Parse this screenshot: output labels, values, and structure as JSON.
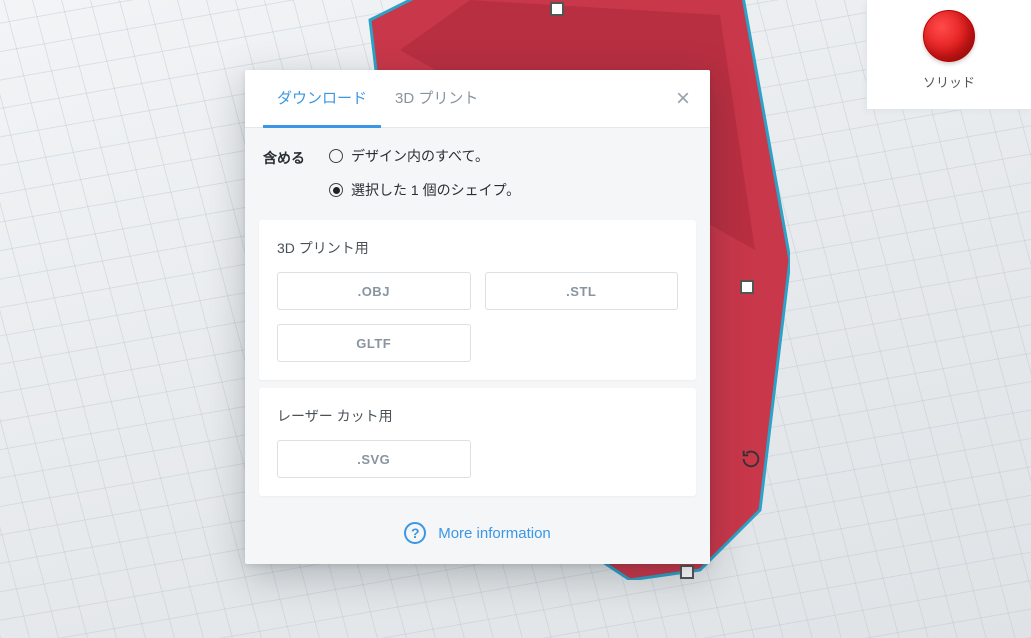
{
  "palette": {
    "label": "ソリッド",
    "swatch_color": "#e01919"
  },
  "dialog": {
    "tabs": {
      "download": "ダウンロード",
      "print3d": "3D プリント"
    },
    "include": {
      "label": "含める",
      "option_all": "デザイン内のすべて。",
      "option_selected": "選択した 1 個のシェイプ。",
      "selected": "option_selected"
    },
    "sections": {
      "print3d": {
        "title": "3D プリント用",
        "formats": {
          "obj": ".OBJ",
          "stl": ".STL",
          "gltf": "GLTF"
        }
      },
      "laser": {
        "title": "レーザー カット用",
        "formats": {
          "svg": ".SVG"
        }
      }
    },
    "more_info": "More information"
  }
}
